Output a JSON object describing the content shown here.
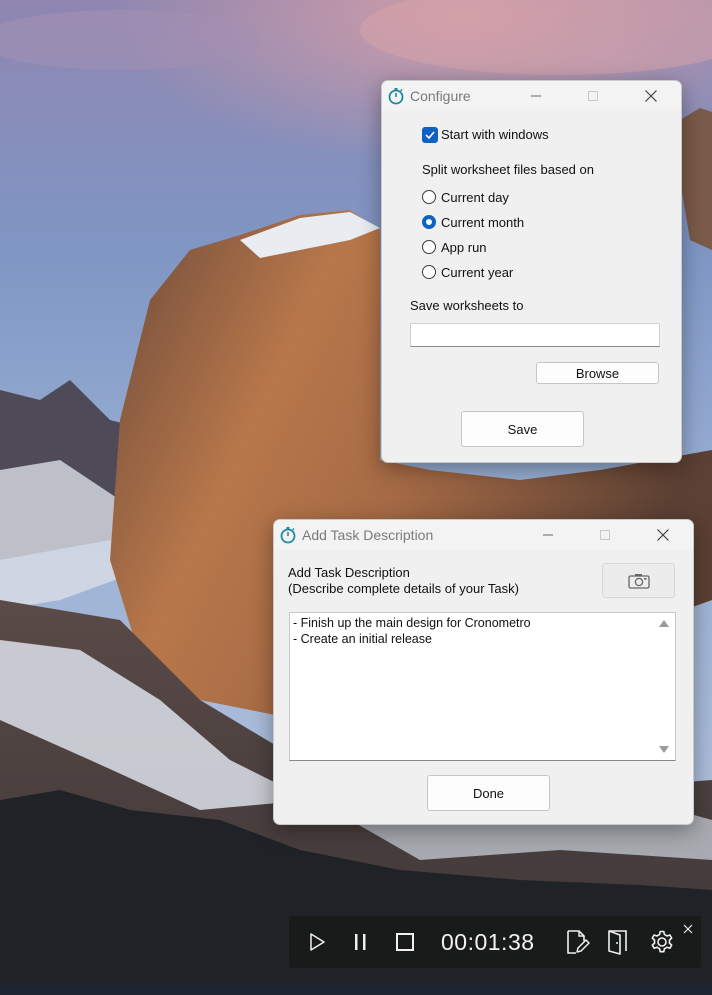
{
  "configure": {
    "title": "Configure",
    "start_with_windows": {
      "label": "Start with windows",
      "checked": true
    },
    "split_heading": "Split worksheet files based on",
    "split_options": [
      {
        "label": "Current day",
        "checked": false
      },
      {
        "label": "Current month",
        "checked": true
      },
      {
        "label": "App run",
        "checked": false
      },
      {
        "label": "Current year",
        "checked": false
      }
    ],
    "save_to_label": "Save worksheets to",
    "save_path_value": "",
    "browse_label": "Browse",
    "save_label": "Save"
  },
  "task": {
    "title": "Add Task Description",
    "heading_line1": "Add Task Description",
    "heading_line2": "(Describe complete details of your Task)",
    "description_lines": [
      "- Finish up the main design for Cronometro",
      "- Create an initial release"
    ],
    "done_label": "Done"
  },
  "timerbar": {
    "elapsed": "00:01:38"
  },
  "icons": {
    "app": "stopwatch-icon",
    "minimize": "minimize-icon",
    "maximize": "maximize-icon",
    "close": "close-icon",
    "screenshot": "camera-icon",
    "play": "play-icon",
    "pause": "pause-icon",
    "stop": "stop-icon",
    "edit_task": "edit-document-icon",
    "open_folder": "open-door-icon",
    "settings": "gear-icon"
  },
  "colors": {
    "accent": "#0f62c4",
    "app_icon": "#1f8a9e",
    "timer_bar": "#181818"
  }
}
